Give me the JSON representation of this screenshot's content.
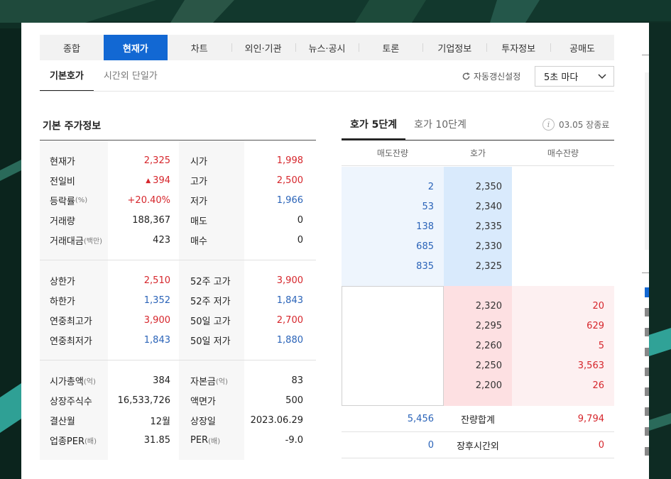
{
  "tabs": [
    "종합",
    "현재가",
    "차트",
    "외인·기관",
    "뉴스·공시",
    "토론",
    "기업정보",
    "투자정보",
    "공매도"
  ],
  "active_tab": 1,
  "subtabs": [
    "기본호가",
    "시간외 단일가"
  ],
  "refresh": {
    "label": "자동갱신설정",
    "interval": "5초 마다"
  },
  "basic": {
    "title": "기본 주가정보",
    "group1": [
      {
        "l1": "현재가",
        "v1": "2,325",
        "c1": "red",
        "l2": "시가",
        "v2": "1,998",
        "c2": "red"
      },
      {
        "l1": "전일비",
        "v1": "394",
        "c1": "red",
        "l2": "고가",
        "v2": "2,500",
        "c2": "red"
      },
      {
        "l1": "등락률",
        "l1s": "(%)",
        "v1": "+20.40%",
        "c1": "red",
        "l2": "저가",
        "v2": "1,966",
        "c2": "blue"
      },
      {
        "l1": "거래량",
        "v1": "188,367",
        "c1": "",
        "l2": "매도",
        "v2": "0",
        "c2": ""
      },
      {
        "l1": "거래대금",
        "l1s": "(백만)",
        "v1": "423",
        "c1": "",
        "l2": "매수",
        "v2": "0",
        "c2": ""
      }
    ],
    "group2": [
      {
        "l1": "상한가",
        "v1": "2,510",
        "c1": "red",
        "l2": "52주 고가",
        "v2": "3,900",
        "c2": "red"
      },
      {
        "l1": "하한가",
        "v1": "1,352",
        "c1": "blue",
        "l2": "52주 저가",
        "v2": "1,843",
        "c2": "blue"
      },
      {
        "l1": "연중최고가",
        "v1": "3,900",
        "c1": "red",
        "l2": "50일 고가",
        "v2": "2,700",
        "c2": "red"
      },
      {
        "l1": "연중최저가",
        "v1": "1,843",
        "c1": "blue",
        "l2": "50일 저가",
        "v2": "1,880",
        "c2": "blue"
      }
    ],
    "group3": [
      {
        "l1": "시가총액",
        "l1s": "(억)",
        "v1": "384",
        "c1": "",
        "l2": "자본금",
        "l2s": "(억)",
        "v2": "83",
        "c2": ""
      },
      {
        "l1": "상장주식수",
        "v1": "16,533,726",
        "c1": "",
        "l2": "액면가",
        "v2": "500",
        "c2": ""
      },
      {
        "l1": "결산월",
        "v1": "12월",
        "c1": "",
        "l2": "상장일",
        "v2": "2023.06.29",
        "c2": ""
      },
      {
        "l1": "업종PER",
        "l1s": "(배)",
        "v1": "31.85",
        "c1": "",
        "l2": "PER",
        "l2s": "(배)",
        "v2": "-9.0",
        "c2": ""
      }
    ]
  },
  "orderbook": {
    "tabs": [
      "호가 5단계",
      "호가 10단계"
    ],
    "time": "03.05 장종료",
    "info_icon": "i",
    "headers": [
      "매도잔량",
      "호가",
      "매수잔량"
    ],
    "asks": [
      {
        "qty": "2",
        "price": "2,350"
      },
      {
        "qty": "53",
        "price": "2,340"
      },
      {
        "qty": "138",
        "price": "2,335"
      },
      {
        "qty": "685",
        "price": "2,330"
      },
      {
        "qty": "835",
        "price": "2,325"
      }
    ],
    "bids": [
      {
        "price": "2,320",
        "qty": "20"
      },
      {
        "price": "2,295",
        "qty": "629"
      },
      {
        "price": "2,260",
        "qty": "5"
      },
      {
        "price": "2,250",
        "qty": "3,563"
      },
      {
        "price": "2,200",
        "qty": "26"
      }
    ],
    "total": {
      "ask": "5,456",
      "label": "잔량합계",
      "bid": "9,794"
    },
    "after": {
      "ask": "0",
      "label": "장후시간외",
      "bid": "0"
    }
  },
  "colors": {
    "accent": "#1268d3",
    "up": "#d6262c",
    "down": "#2a63b8"
  }
}
